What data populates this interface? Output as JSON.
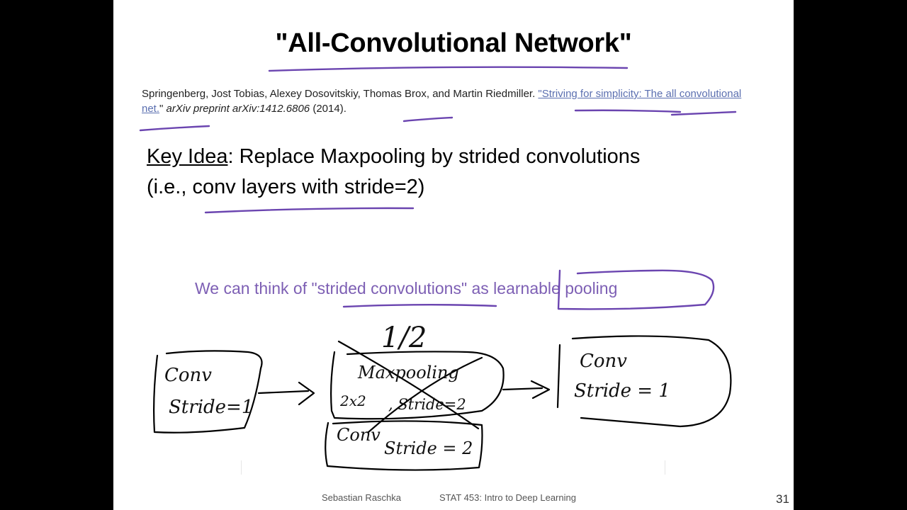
{
  "slide": {
    "title": "\"All-Convolutional Network\"",
    "citation": {
      "authors": "Springenberg, Jost Tobias, Alexey Dosovitskiy, Thomas Brox, and Martin Riedmiller.",
      "link_text": "\"Striving for simplicity: The all convolutional net.",
      "after_link": "\"",
      "venue": "arXiv preprint arXiv:1412.6806",
      "year": "(2014)."
    },
    "key_idea": {
      "label": "Key Idea",
      "line1_rest": ": Replace Maxpooling by strided convolutions",
      "line2": "(i.e., conv layers with stride=2)"
    },
    "note": "We can think of \"strided convolutions\" as learnable pooling",
    "footer": {
      "author": "Sebastian Raschka",
      "course": "STAT 453: Intro to Deep Learning",
      "page": "31"
    }
  },
  "annotations": {
    "fraction": "1/2",
    "box_left": {
      "line1": "Conv",
      "line2": "Stride=1"
    },
    "box_middle": {
      "line1": "Maxpooling",
      "line2": "2x2",
      "line3": ", Stride=2"
    },
    "box_bottom": {
      "line1": "Conv",
      "line2": "Stride = 2"
    },
    "box_right": {
      "line1": "Conv",
      "line2": "Stride = 1"
    },
    "ink_color": "#6b45b0",
    "handwriting_color": "#111111"
  }
}
